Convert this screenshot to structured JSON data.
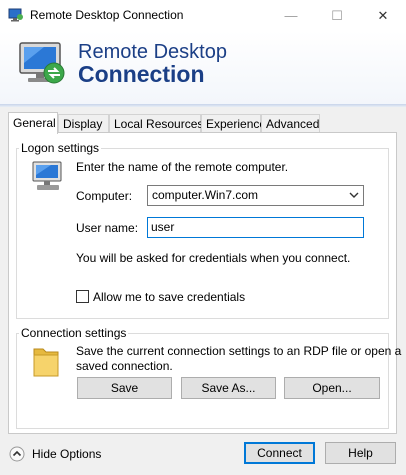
{
  "window": {
    "title": "Remote Desktop Connection",
    "controls": {
      "minimize": "—",
      "maximize": "☐",
      "close": "✕"
    }
  },
  "banner": {
    "line1": "Remote Desktop",
    "line2": "Connection"
  },
  "tabs": [
    {
      "label": "General",
      "active": true
    },
    {
      "label": "Display",
      "active": false
    },
    {
      "label": "Local Resources",
      "active": false
    },
    {
      "label": "Experience",
      "active": false
    },
    {
      "label": "Advanced",
      "active": false
    }
  ],
  "logon": {
    "group_label": "Logon settings",
    "prompt": "Enter the name of the remote computer.",
    "computer_label": "Computer:",
    "computer_value": "computer.Win7.com",
    "username_label": "User name:",
    "username_value": "user",
    "credentials_note": "You will be asked for credentials when you connect.",
    "save_credentials_label": "Allow me to save credentials",
    "save_credentials_checked": false
  },
  "connection": {
    "group_label": "Connection settings",
    "description_line1": "Save the current connection settings to an RDP file or open a",
    "description_line2": "saved connection.",
    "save_label": "Save",
    "save_as_label": "Save As...",
    "open_label": "Open..."
  },
  "footer": {
    "hide_options_label": "Hide Options",
    "connect_label": "Connect",
    "help_label": "Help"
  },
  "colors": {
    "banner_text": "#1b3f86",
    "focus_border": "#0078d7"
  }
}
